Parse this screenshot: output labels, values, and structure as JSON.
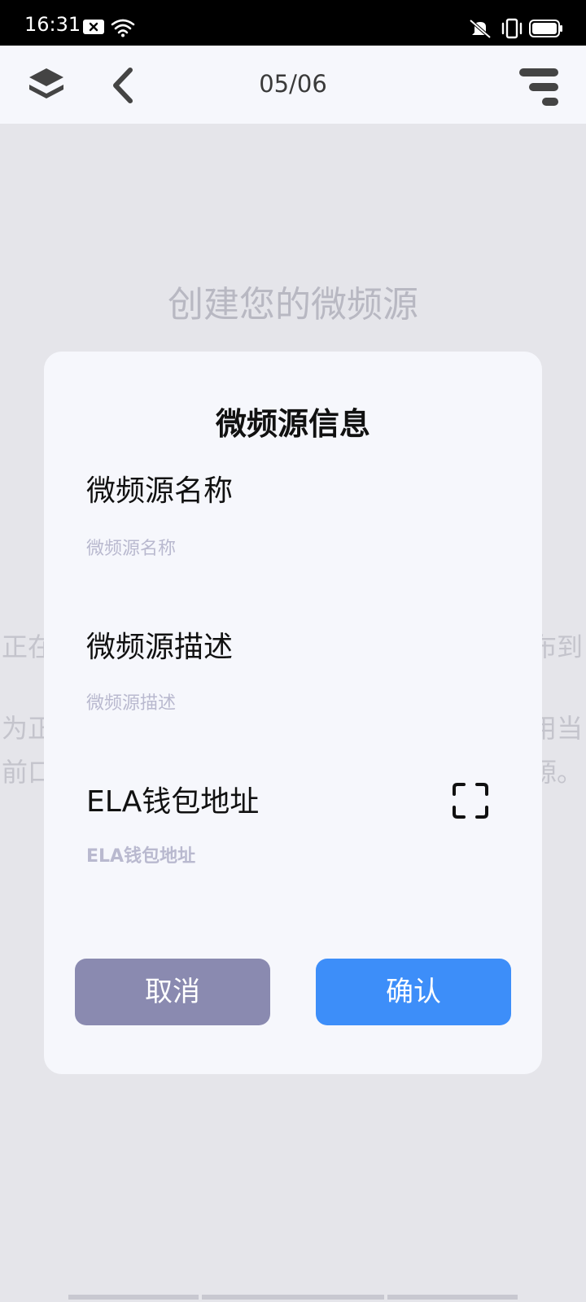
{
  "status_bar": {
    "time": "16:31",
    "icons": [
      "notification-x-icon",
      "wifi-icon",
      "mute-icon",
      "vibrate-icon",
      "battery-icon"
    ]
  },
  "top_nav": {
    "page_indicator": "05/06",
    "icons": [
      "layers-icon",
      "back-icon",
      "menu-icon"
    ]
  },
  "background": {
    "title": "创建您的微频源",
    "line1_left": "正在",
    "line1_right": "布到",
    "line2_left": "为正",
    "line2_right": "用当",
    "line3_left": "前口",
    "line3_right": "源。"
  },
  "modal": {
    "title": "微频源信息",
    "fields": [
      {
        "label": "微频源名称",
        "placeholder": "微频源名称",
        "value": ""
      },
      {
        "label": "微频源描述",
        "placeholder": "微频源描述",
        "value": ""
      },
      {
        "label": "ELA钱包地址",
        "placeholder": "ELA钱包地址",
        "value": ""
      }
    ],
    "cancel_label": "取消",
    "confirm_label": "确认"
  },
  "colors": {
    "accent": "#3d8ef9",
    "cancel": "#8a8ab0",
    "placeholder": "#b9b9cf",
    "modal_bg": "#f6f7fc",
    "page_bg": "#e5e5ea"
  }
}
